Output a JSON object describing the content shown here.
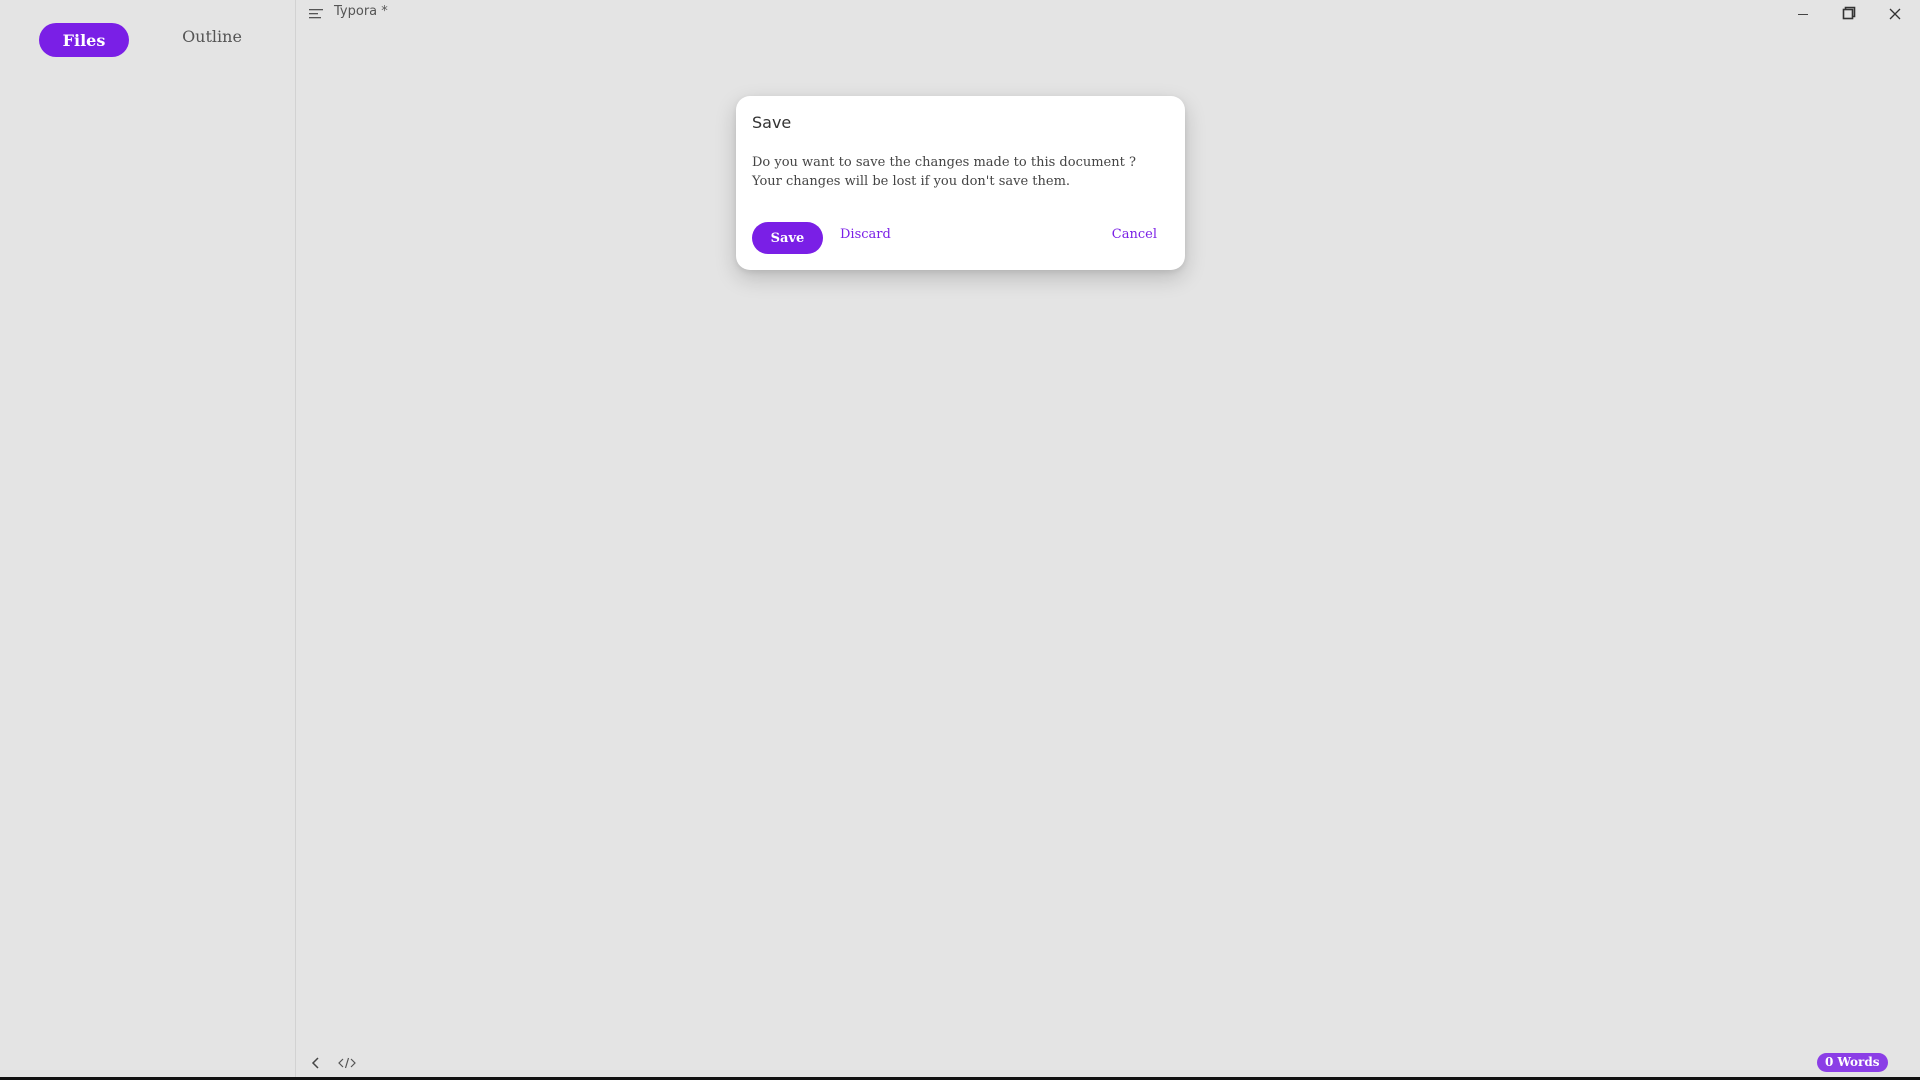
{
  "window": {
    "title": "Typora *"
  },
  "sidebar": {
    "tabs": [
      {
        "label": "Files",
        "active": true
      },
      {
        "label": "Outline",
        "active": false
      }
    ]
  },
  "dialog": {
    "title": "Save",
    "message_line1": "Do you want to save the changes made to this document ?",
    "message_line2": "Your changes will be lost if you don't save them.",
    "save_label": "Save",
    "discard_label": "Discard",
    "cancel_label": "Cancel"
  },
  "footer": {
    "word_count": "0 Words",
    "icons": [
      "chevron-left-icon",
      "source-code-icon"
    ]
  },
  "colors": {
    "accent": "#7a1fe6",
    "background": "#e4e4e4",
    "dialog_bg": "#ffffff"
  }
}
